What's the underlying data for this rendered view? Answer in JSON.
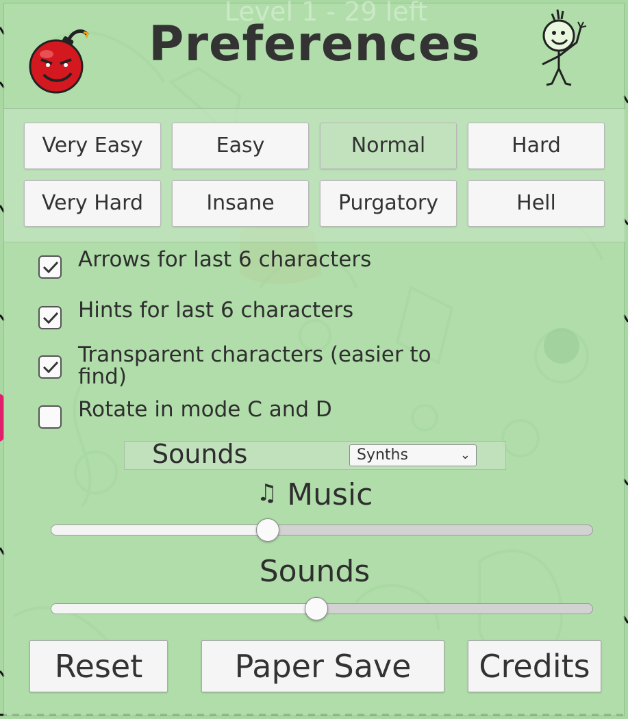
{
  "window": {
    "ghost_title": "Level 1 - 29 left",
    "title": "Preferences"
  },
  "difficulty": {
    "selected": "Normal",
    "levels": [
      "Very Easy",
      "Easy",
      "Normal",
      "Hard",
      "Very Hard",
      "Insane",
      "Purgatory",
      "Hell"
    ]
  },
  "options": [
    {
      "label": "Arrows for last 6 characters",
      "checked": true
    },
    {
      "label": "Hints for last 6 characters",
      "checked": true
    },
    {
      "label": "Transparent characters (easier to find)",
      "checked": true
    },
    {
      "label": "Rotate in mode C and D",
      "checked": false
    }
  ],
  "sounds_select": {
    "label": "Sounds",
    "value": "Synths"
  },
  "sliders": {
    "music": {
      "label": "Music",
      "icon": "music-note-icon",
      "value_fraction": 0.4
    },
    "sounds": {
      "label": "Sounds",
      "value_fraction": 0.49
    }
  },
  "buttons": {
    "reset": "Reset",
    "paper_save": "Paper Save",
    "credits": "Credits"
  },
  "colors": {
    "panel": "#b2deac",
    "button": "#f6f6f6",
    "text": "#2e2e2e",
    "bomb": "#d41820"
  }
}
